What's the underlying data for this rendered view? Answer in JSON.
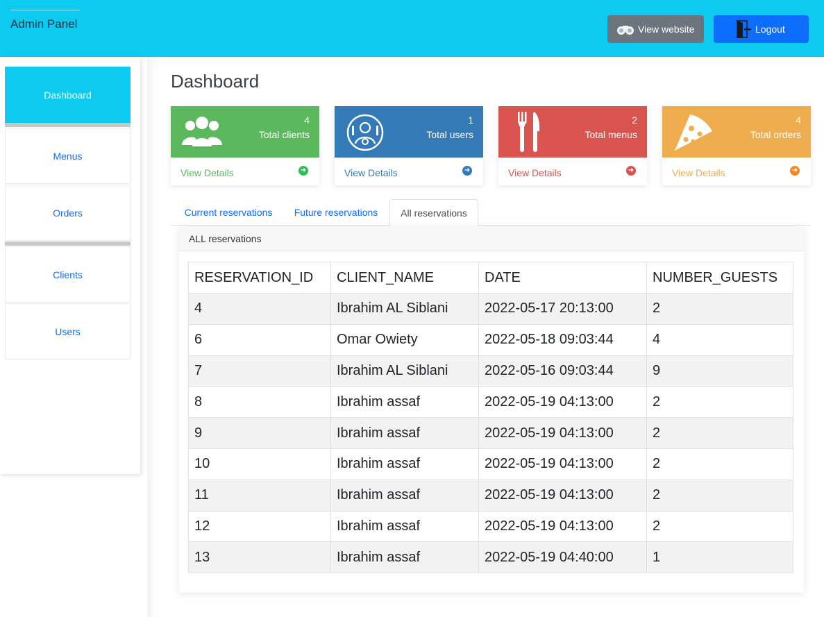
{
  "header": {
    "brand": "Admin Panel",
    "view_website": "View website",
    "logout": "Logout"
  },
  "sidebar": {
    "items": [
      {
        "label": "Dashboard",
        "active": true
      },
      {
        "label": "Menus"
      },
      {
        "label": "Orders"
      },
      {
        "label": "Clients"
      },
      {
        "label": "Users"
      }
    ]
  },
  "page": {
    "title": "Dashboard"
  },
  "cards": [
    {
      "count": "4",
      "label": "Total clients",
      "link": "View Details",
      "color": "#5cb85c",
      "icon": "users-icon"
    },
    {
      "count": "1",
      "label": "Total users",
      "link": "View Details",
      "color": "#337ab7",
      "icon": "user-gear-icon"
    },
    {
      "count": "2",
      "label": "Total menus",
      "link": "View Details",
      "color": "#d9534f",
      "icon": "fork-knife-icon"
    },
    {
      "count": "4",
      "label": "Total orders",
      "link": "View Details",
      "color": "#f0ad4e",
      "icon": "pizza-icon"
    }
  ],
  "tabs": [
    {
      "label": "Current reservations"
    },
    {
      "label": "Future reservations"
    },
    {
      "label": "All reservations",
      "active": true
    }
  ],
  "panel": {
    "title": "ALL reservations",
    "columns": [
      "RESERVATION_ID",
      "CLIENT_NAME",
      "DATE",
      "NUMBER_GUESTS"
    ],
    "rows": [
      [
        "4",
        "Ibrahim AL Siblani",
        "2022-05-17 20:13:00",
        "2"
      ],
      [
        "6",
        "Omar Owiety",
        "2022-05-18 09:03:44",
        "4"
      ],
      [
        "7",
        "Ibrahim AL Siblani",
        "2022-05-16 09:03:44",
        "9"
      ],
      [
        "8",
        "Ibrahim assaf",
        "2022-05-19 04:13:00",
        "2"
      ],
      [
        "9",
        "Ibrahim assaf",
        "2022-05-19 04:13:00",
        "2"
      ],
      [
        "10",
        "Ibrahim assaf",
        "2022-05-19 04:13:00",
        "2"
      ],
      [
        "11",
        "Ibrahim assaf",
        "2022-05-19 04:13:00",
        "2"
      ],
      [
        "12",
        "Ibrahim assaf",
        "2022-05-19 04:13:00",
        "2"
      ],
      [
        "13",
        "Ibrahim assaf",
        "2022-05-19 04:40:00",
        "1"
      ]
    ]
  }
}
